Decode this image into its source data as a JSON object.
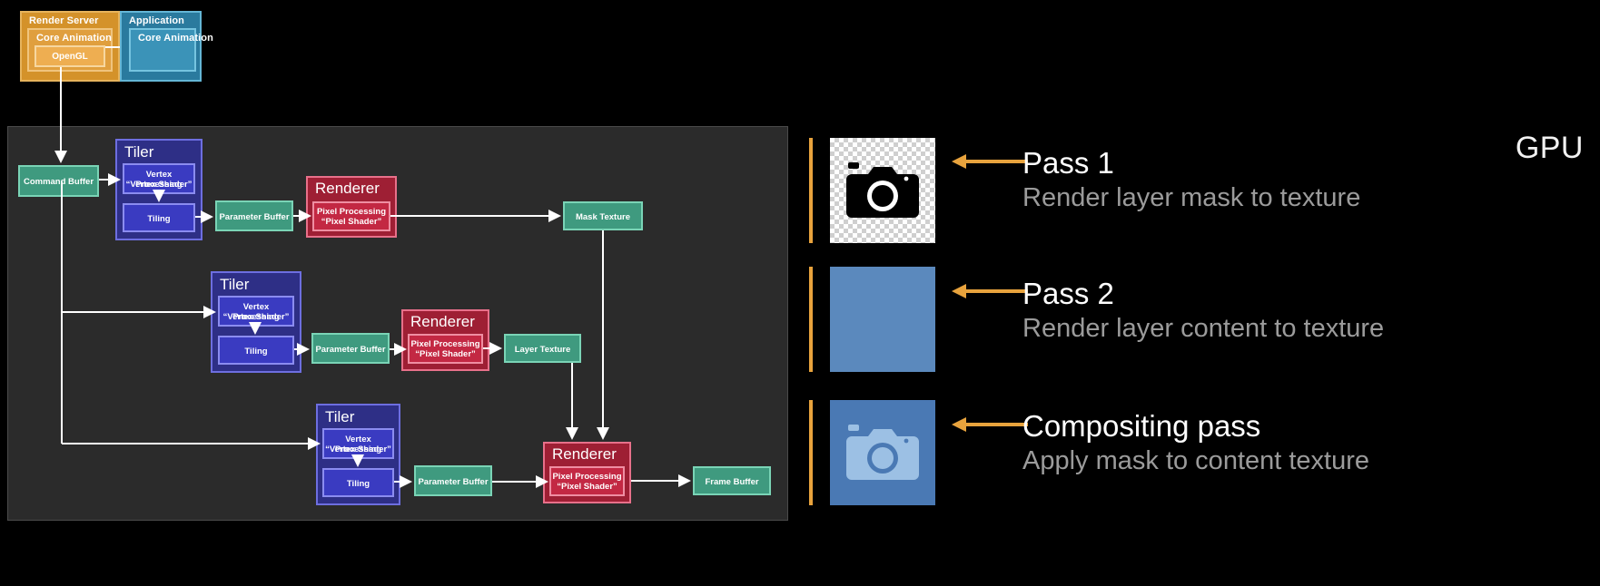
{
  "diagram": {
    "gpu_label": "GPU",
    "top": {
      "render_server": {
        "title": "Render Server",
        "core_animation": "Core Animation",
        "opengl": "OpenGL"
      },
      "application": {
        "title": "Application",
        "core_animation": "Core Animation"
      }
    },
    "command_buffer": "Command Buffer",
    "tiler_title": "Tiler",
    "renderer_title": "Renderer",
    "vertex_processing_line1": "Vertex Processing",
    "vertex_processing_line2": "“Vertex Shader”",
    "tiling": "Tiling",
    "pixel_processing_line1": "Pixel Processing",
    "pixel_processing_line2": "“Pixel Shader”",
    "parameter_buffer": "Parameter Buffer",
    "mask_texture": "Mask Texture",
    "layer_texture": "Layer Texture",
    "frame_buffer": "Frame Buffer"
  },
  "passes": [
    {
      "title": "Pass 1",
      "subtitle": "Render layer mask to texture",
      "thumb": "checker-camera-black",
      "bar_color": "#e8a33d"
    },
    {
      "title": "Pass 2",
      "subtitle": "Render layer content to texture",
      "thumb": "solid-blue",
      "bar_color": "#e8a33d"
    },
    {
      "title": "Compositing pass",
      "subtitle": "Apply mask to content texture",
      "thumb": "blue-camera-light",
      "bar_color": "#e8a33d"
    }
  ],
  "colors": {
    "background": "#000000",
    "gpu_panel": "#2b2b2b",
    "tiler": "#2e2f86",
    "tiler_inner": "#3a3bc1",
    "renderer": "#9e1f34",
    "renderer_inner": "#c32843",
    "buffer": "#3f9a7f",
    "render_server": "#d4922a",
    "application": "#2a7a9e",
    "accent_orange": "#e8a33d",
    "arrow": "#ffffff"
  }
}
